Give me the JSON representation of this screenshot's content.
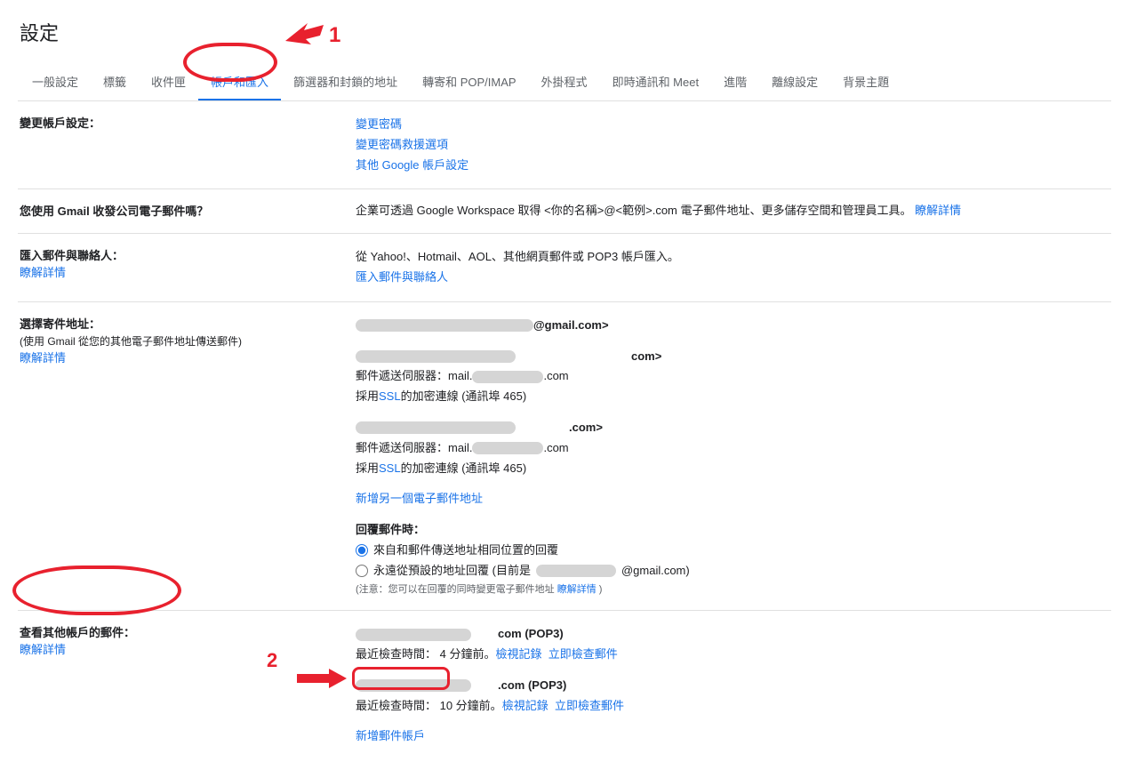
{
  "pageTitle": "設定",
  "tabs": [
    {
      "label": "一般設定"
    },
    {
      "label": "標籤"
    },
    {
      "label": "收件匣"
    },
    {
      "label": "帳戶和匯入",
      "active": true
    },
    {
      "label": "篩選器和封鎖的地址"
    },
    {
      "label": "轉寄和 POP/IMAP"
    },
    {
      "label": "外掛程式"
    },
    {
      "label": "即時通訊和 Meet"
    },
    {
      "label": "進階"
    },
    {
      "label": "離線設定"
    },
    {
      "label": "背景主題"
    }
  ],
  "changeAccount": {
    "label": "變更帳戶設定：",
    "links": {
      "changePassword": "變更密碼",
      "recovery": "變更密碼救援選項",
      "otherGoogle": "其他 Google 帳戶設定"
    }
  },
  "gmailCompany": {
    "label": "您使用 Gmail 收發公司電子郵件嗎？",
    "textParts": {
      "t1": "企業可透過 Google Workspace 取得 <你的名稱>@<範例>.com 電子郵件地址、更多儲存空間和管理員工具。",
      "learnMore": "瞭解詳情"
    }
  },
  "importMail": {
    "label": "匯入郵件與聯絡人：",
    "learnMore": "瞭解詳情",
    "text": "從 Yahoo!、Hotmail、AOL、其他網頁郵件或 POP3 帳戶匯入。",
    "importLink": "匯入郵件與聯絡人"
  },
  "sendAs": {
    "label": "選擇寄件地址：",
    "sub": "(使用 Gmail 從您的其他電子郵件地址傳送郵件)",
    "learnMore": "瞭解詳情",
    "addr1Suffix": "@gmail.com>",
    "addr2Suffix": "com>",
    "addr3Suffix": ".com>",
    "serverPrefix": "郵件遞送伺服器：mail.",
    "serverSuffix": ".com",
    "sslPrefix": "採用 ",
    "ssl": "SSL",
    "sslSuffix": " 的加密連線 (通訊埠 465)",
    "addAnother": "新增另一個電子郵件地址",
    "replyHeader": "回覆郵件時：",
    "replyOpt1": "來自和郵件傳送地址相同位置的回覆",
    "replyOpt2Prefix": "永遠從預設的地址回覆 (目前是",
    "replyOpt2Suffix": "@gmail.com)",
    "notePrefix": "(注意：您可以在回覆的同時變更電子郵件地址 ",
    "noteLink": "瞭解詳情",
    "noteSuffix": ")"
  },
  "checkOther": {
    "label": "查看其他帳戶的郵件：",
    "learnMore": "瞭解詳情",
    "acct1Suffix": "com (POP3)",
    "acct2Suffix": ".com (POP3)",
    "lastCheck1": "最近檢查時間： 4 分鐘前。 ",
    "lastCheck2": "最近檢查時間： 10 分鐘前。 ",
    "viewLog": "檢視記錄",
    "checkNow": "立即檢查郵件",
    "addMailAccount": "新增郵件帳戶"
  },
  "annotations": {
    "label1": "1",
    "label2": "2"
  }
}
